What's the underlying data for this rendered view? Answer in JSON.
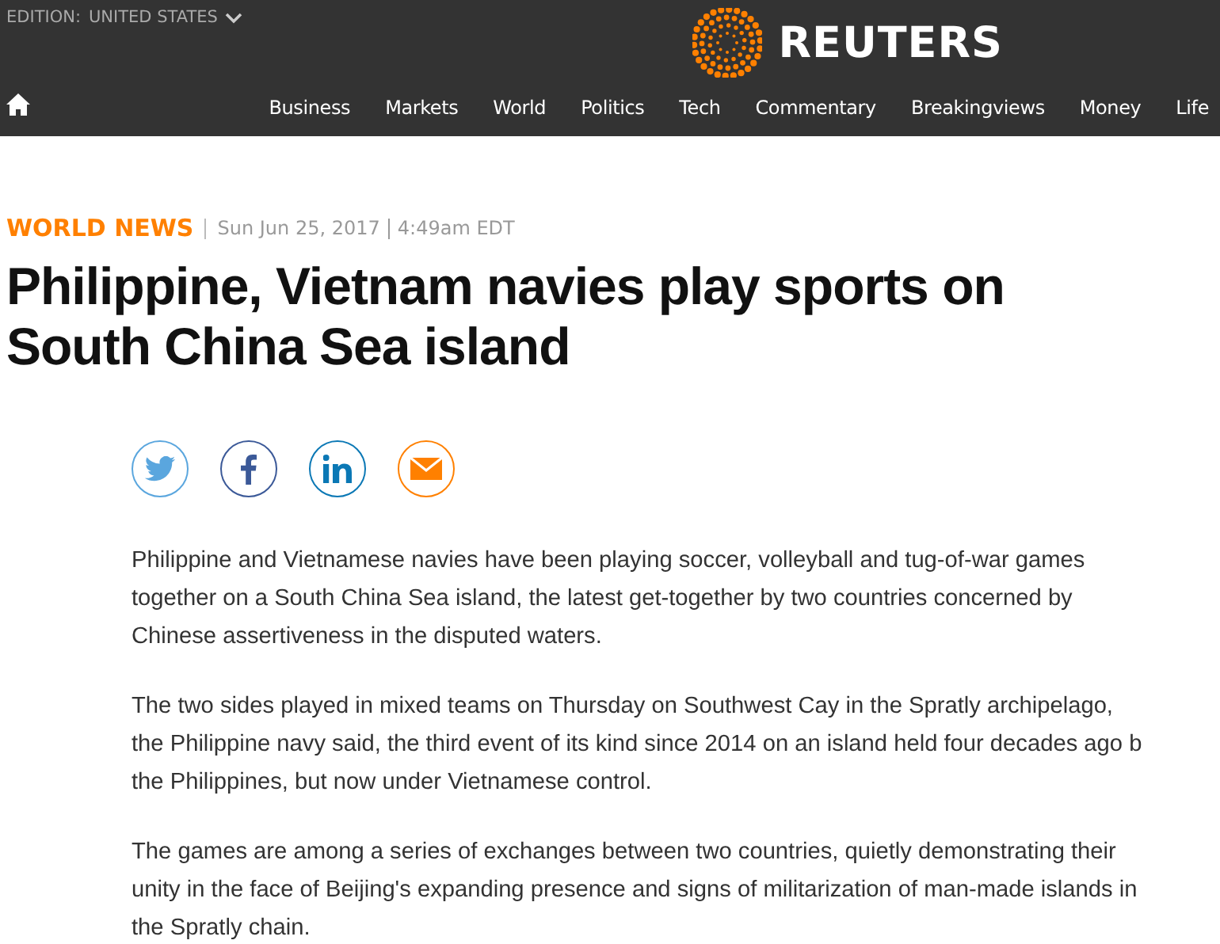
{
  "header": {
    "edition_label": "EDITION:",
    "edition": "UNITED STATES",
    "logo": "REUTERS"
  },
  "nav": [
    {
      "label": "Business"
    },
    {
      "label": "Markets"
    },
    {
      "label": "World"
    },
    {
      "label": "Politics"
    },
    {
      "label": "Tech"
    },
    {
      "label": "Commentary"
    },
    {
      "label": "Breakingviews"
    },
    {
      "label": "Money"
    },
    {
      "label": "Life"
    }
  ],
  "article": {
    "section": "WORLD NEWS",
    "date": "Sun Jun 25, 2017",
    "time": "4:49am EDT",
    "headline": "Philippine, Vietnam navies play sports on South China Sea island",
    "share": [
      {
        "kind": "twitter"
      },
      {
        "kind": "facebook"
      },
      {
        "kind": "linkedin"
      },
      {
        "kind": "email"
      }
    ],
    "paragraphs": [
      {
        "lines": [
          "Philippine and Vietnamese navies have been playing soccer, volleyball and tug-of-war games",
          "together on a South China Sea island, the latest get-together by two countries concerned by",
          "Chinese assertiveness in the disputed waters."
        ]
      },
      {
        "lines": [
          "The two sides played in mixed teams on Thursday on Southwest Cay in the Spratly archipelago,",
          "the Philippine navy said, the third event of its kind since 2014 on an island held four decades ago b",
          "the Philippines, but now under Vietnamese control."
        ]
      },
      {
        "lines": [
          "The games are among a series of exchanges between two countries, quietly demonstrating their",
          "unity in the face of Beijing's expanding presence and signs of militarization of man-made islands in",
          "the Spratly chain."
        ]
      }
    ]
  }
}
